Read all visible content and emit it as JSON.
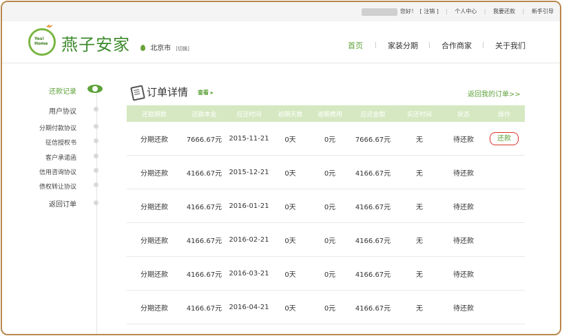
{
  "topbar": {
    "greeting": "您好！",
    "logout": "[ 注销 ]",
    "personal_center": "个人中心",
    "my_repayment": "我要还款",
    "newbie_guide": "新手引导"
  },
  "header": {
    "logo_badge_line1": "Yes!",
    "logo_badge_line2": "Home",
    "logo_text": "燕子安家",
    "city": "北京市",
    "city_switch": "[切换]",
    "nav": [
      "首页",
      "家装分期",
      "合作商家",
      "关于我们"
    ],
    "active_nav": "首页"
  },
  "sidebar": {
    "items": [
      "还款记录",
      "用户协议",
      "分期付款协议",
      "征信授权书",
      "客户承诺函",
      "信用咨询协议",
      "债权转让协议",
      "返回订单"
    ],
    "active": "还款记录"
  },
  "main": {
    "title": "订单详情",
    "view_link": "查看 ▸",
    "back_link": "返回我的订单>>",
    "columns": [
      "还款期数",
      "还款本金",
      "应还时间",
      "逾期天数",
      "逾期费用",
      "应还金额",
      "实还时间",
      "状态",
      "操作"
    ],
    "rows": [
      [
        "分期还款",
        "7666.67元",
        "2015-11-21",
        "0天",
        "0元",
        "7666.67元",
        "无",
        "待还款",
        "还款"
      ],
      [
        "分期还款",
        "4166.67元",
        "2015-12-21",
        "0天",
        "0元",
        "4166.67元",
        "无",
        "待还款",
        ""
      ],
      [
        "分期还款",
        "4166.67元",
        "2016-01-21",
        "0天",
        "0元",
        "4166.67元",
        "无",
        "待还款",
        ""
      ],
      [
        "分期还款",
        "4166.67元",
        "2016-02-21",
        "0天",
        "0元",
        "4166.67元",
        "无",
        "待还款",
        ""
      ],
      [
        "分期还款",
        "4166.67元",
        "2016-03-21",
        "0天",
        "0元",
        "4166.67元",
        "无",
        "待还款",
        ""
      ],
      [
        "分期还款",
        "4166.67元",
        "2016-04-21",
        "0天",
        "0元",
        "4166.67元",
        "无",
        "待还款",
        ""
      ]
    ]
  },
  "colors": {
    "accent": "#5ea23a",
    "header_row": "#d5e8c1",
    "pay_button_border": "#d9332b",
    "frame": "#b8864b"
  }
}
